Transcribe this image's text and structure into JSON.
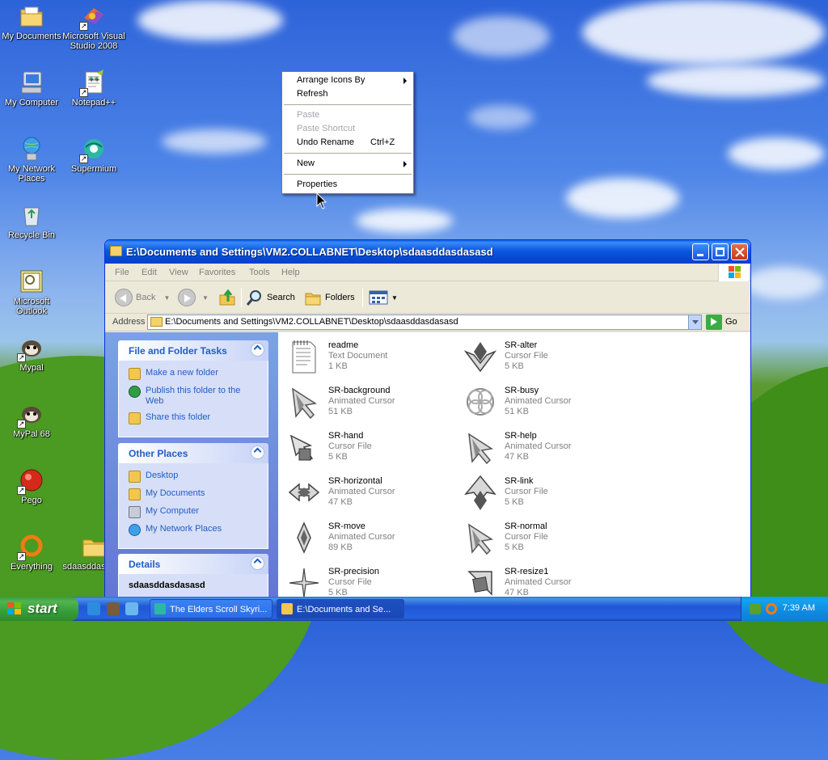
{
  "desktop": {
    "icons": [
      {
        "label": "My Documents",
        "icon": "my-documents-icon",
        "shortcut": false
      },
      {
        "label": "Microsoft Visual Studio 2008",
        "icon": "visual-studio-icon",
        "shortcut": true
      },
      {
        "label": "My Computer",
        "icon": "my-computer-icon",
        "shortcut": false
      },
      {
        "label": "Notepad++",
        "icon": "notepad-plus-plus-icon",
        "shortcut": true
      },
      {
        "label": "My Network Places",
        "icon": "network-places-icon",
        "shortcut": false
      },
      {
        "label": "Supermium",
        "icon": "supermium-icon",
        "shortcut": true
      },
      {
        "label": "Recycle Bin",
        "icon": "recycle-bin-icon",
        "shortcut": false
      },
      {
        "label": "Microsoft Outlook",
        "icon": "outlook-icon",
        "shortcut": false
      },
      {
        "label": "Mypal",
        "icon": "mypal-icon",
        "shortcut": true
      },
      {
        "label": "MyPal 68",
        "icon": "mypal-68-icon",
        "shortcut": true
      },
      {
        "label": "Pego",
        "icon": "pego-icon",
        "shortcut": true
      },
      {
        "label": "Everything",
        "icon": "everything-icon",
        "shortcut": true
      },
      {
        "label": "sdaasddasdasd",
        "icon": "folder-icon",
        "shortcut": false
      }
    ]
  },
  "context_menu": {
    "items": [
      {
        "label": "Arrange Icons By",
        "submenu": true,
        "disabled": false
      },
      {
        "label": "Refresh",
        "submenu": false,
        "disabled": false
      },
      {
        "label": "Paste",
        "submenu": false,
        "disabled": true
      },
      {
        "label": "Paste Shortcut",
        "submenu": false,
        "disabled": true
      },
      {
        "label": "Undo Rename",
        "shortcut": "Ctrl+Z",
        "submenu": false,
        "disabled": false
      },
      {
        "label": "New",
        "submenu": true,
        "disabled": false
      },
      {
        "label": "Properties",
        "submenu": false,
        "disabled": false
      }
    ]
  },
  "explorer": {
    "title": "E:\\Documents and Settings\\VM2.COLLABNET\\Desktop\\sdaasddasdasasd",
    "menu": [
      "File",
      "Edit",
      "View",
      "Favorites",
      "Tools",
      "Help"
    ],
    "toolbar": {
      "back": "Back",
      "search": "Search",
      "folders": "Folders"
    },
    "address": {
      "label": "Address",
      "value": "E:\\Documents and Settings\\VM2.COLLABNET\\Desktop\\sdaasddasdasasd",
      "go": "Go"
    },
    "task_panels": {
      "file_folder": {
        "title": "File and Folder Tasks",
        "links": [
          {
            "label": "Make a new folder",
            "icon": "new-folder-icon"
          },
          {
            "label": "Publish this folder to the Web",
            "icon": "publish-web-icon"
          },
          {
            "label": "Share this folder",
            "icon": "share-folder-icon"
          }
        ]
      },
      "other_places": {
        "title": "Other Places",
        "links": [
          {
            "label": "Desktop",
            "icon": "desktop-folder-icon"
          },
          {
            "label": "My Documents",
            "icon": "my-documents-icon"
          },
          {
            "label": "My Computer",
            "icon": "my-computer-icon"
          },
          {
            "label": "My Network Places",
            "icon": "network-places-icon"
          }
        ]
      },
      "details": {
        "title": "Details",
        "name": "sdaasddasdasasd"
      }
    },
    "files": [
      {
        "name": "readme",
        "type": "Text Document",
        "size": "1 KB",
        "icon": "text-document-icon"
      },
      {
        "name": "SR-alter",
        "type": "Cursor File",
        "size": "5 KB",
        "icon": "cursor-file-icon"
      },
      {
        "name": "SR-background",
        "type": "Animated Cursor",
        "size": "51 KB",
        "icon": "animated-cursor-icon"
      },
      {
        "name": "SR-busy",
        "type": "Animated Cursor",
        "size": "51 KB",
        "icon": "busy-cursor-icon"
      },
      {
        "name": "SR-hand",
        "type": "Cursor File",
        "size": "5 KB",
        "icon": "cursor-file-icon"
      },
      {
        "name": "SR-help",
        "type": "Animated Cursor",
        "size": "47 KB",
        "icon": "animated-cursor-icon"
      },
      {
        "name": "SR-horizontal",
        "type": "Animated Cursor",
        "size": "47 KB",
        "icon": "horizontal-cursor-icon"
      },
      {
        "name": "SR-link",
        "type": "Cursor File",
        "size": "5 KB",
        "icon": "link-cursor-icon"
      },
      {
        "name": "SR-move",
        "type": "Animated Cursor",
        "size": "89 KB",
        "icon": "move-cursor-icon"
      },
      {
        "name": "SR-normal",
        "type": "Cursor File",
        "size": "5 KB",
        "icon": "cursor-file-icon"
      },
      {
        "name": "SR-precision",
        "type": "Cursor File",
        "size": "5 KB",
        "icon": "precision-cursor-icon"
      },
      {
        "name": "SR-resize1",
        "type": "Animated Cursor",
        "size": "47 KB",
        "icon": "resize-cursor-icon"
      }
    ]
  },
  "taskbar": {
    "start_label": "start",
    "tasks": [
      {
        "label": "The Elders Scroll Skyri...",
        "icon": "browser-icon"
      },
      {
        "label": "E:\\Documents and Se...",
        "icon": "folder-icon"
      }
    ],
    "clock": "7:39 AM"
  }
}
